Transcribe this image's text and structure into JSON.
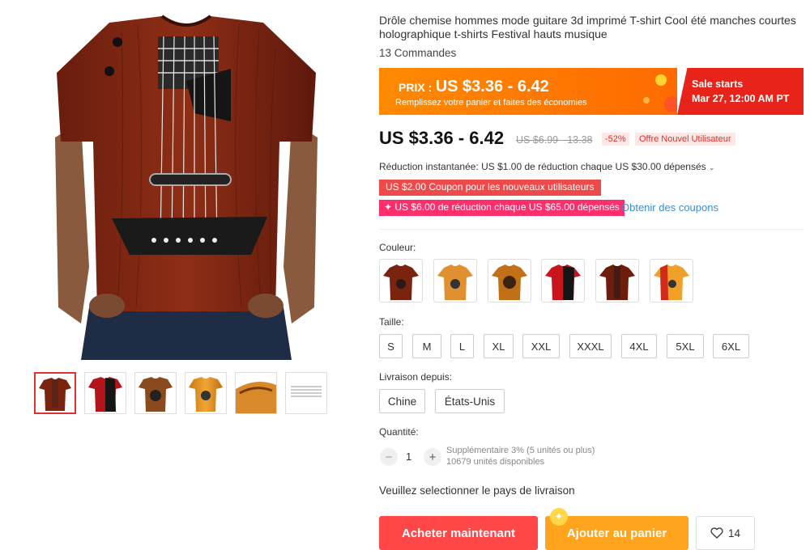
{
  "product": {
    "title": "Drôle chemise hommes mode guitare 3d imprimé T-shirt Cool été manches courtes holographique t-shirts Festival hauts musique",
    "orders": "13 Commandes"
  },
  "banner": {
    "prix_label": "PRIX :",
    "price": "US $3.36 - 6.42",
    "subtitle": "Remplissez votre panier et faites des économies",
    "sale_label": "Sale starts",
    "sale_date": "Mar 27, 12:00 AM PT",
    "color_left": "#ff7a00",
    "color_right": "#e8241a"
  },
  "pricing": {
    "price": "US $3.36 - 6.42",
    "old_price": "US $6.99 - 13.38",
    "discount": "-52%",
    "new_user": "Offre Nouvel Utilisateur"
  },
  "coupons": {
    "instant": "Réduction instantanée: US $1.00 de réduction chaque US $30.00 dépensés",
    "coupon1": "US $2.00 Coupon pour les nouveaux utilisateurs",
    "coupon2": "US $6.00 de réduction chaque US $65.00 dépensés",
    "coupon2_icon": "sparkle-icon",
    "get_coupons": "Obtenir des coupons"
  },
  "options": {
    "color_label": "Couleur:",
    "size_label": "Taille:",
    "sizes": [
      "S",
      "M",
      "L",
      "XL",
      "XXL",
      "XXXL",
      "4XL",
      "5XL",
      "6XL"
    ],
    "ship_label": "Livraison depuis:",
    "ship_from": [
      "Chine",
      "États-Unis"
    ]
  },
  "quantity": {
    "label": "Quantité:",
    "minus": "−",
    "value": "1",
    "plus": "+",
    "extra": "Supplémentaire 3% (5 unités ou plus)",
    "stock": "10679 unités disponibles"
  },
  "actions": {
    "ship_msg": "Veuillez selectionner le pays de livraison",
    "buy_now": "Acheter maintenant",
    "add_cart": "Ajouter au panier",
    "wish_count": "14"
  }
}
